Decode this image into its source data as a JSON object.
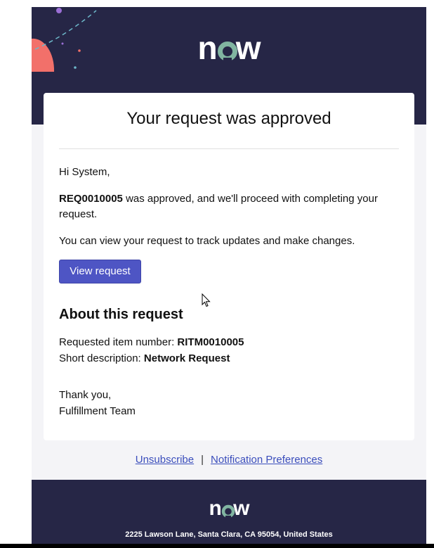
{
  "header": {
    "logo_text_pre": "n",
    "logo_text_o": "o",
    "logo_text_post": "w"
  },
  "card": {
    "title": "Your request was approved",
    "greeting": "Hi System,",
    "request_number": "REQ0010005",
    "approved_text": " was approved, and we'll proceed with completing your request.",
    "track_text": "You can view your request to track updates and make changes.",
    "view_button": "View request",
    "about_title": "About this request",
    "item_label": "Requested item number: ",
    "item_value": "RITM0010005",
    "desc_label": "Short description: ",
    "desc_value": "Network Request",
    "thanks": "Thank you,",
    "team": "Fulfillment Team"
  },
  "footer": {
    "unsubscribe": "Unsubscribe",
    "separator": "|",
    "preferences": "Notification Preferences",
    "address": "2225 Lawson Lane, Santa Clara, CA 95054, United States"
  },
  "colors": {
    "header_bg": "#262646",
    "button_bg": "#4e55c4",
    "logo_accent": "#81b5a1",
    "decor_coral": "#f2706a",
    "link": "#3b4ebc"
  }
}
